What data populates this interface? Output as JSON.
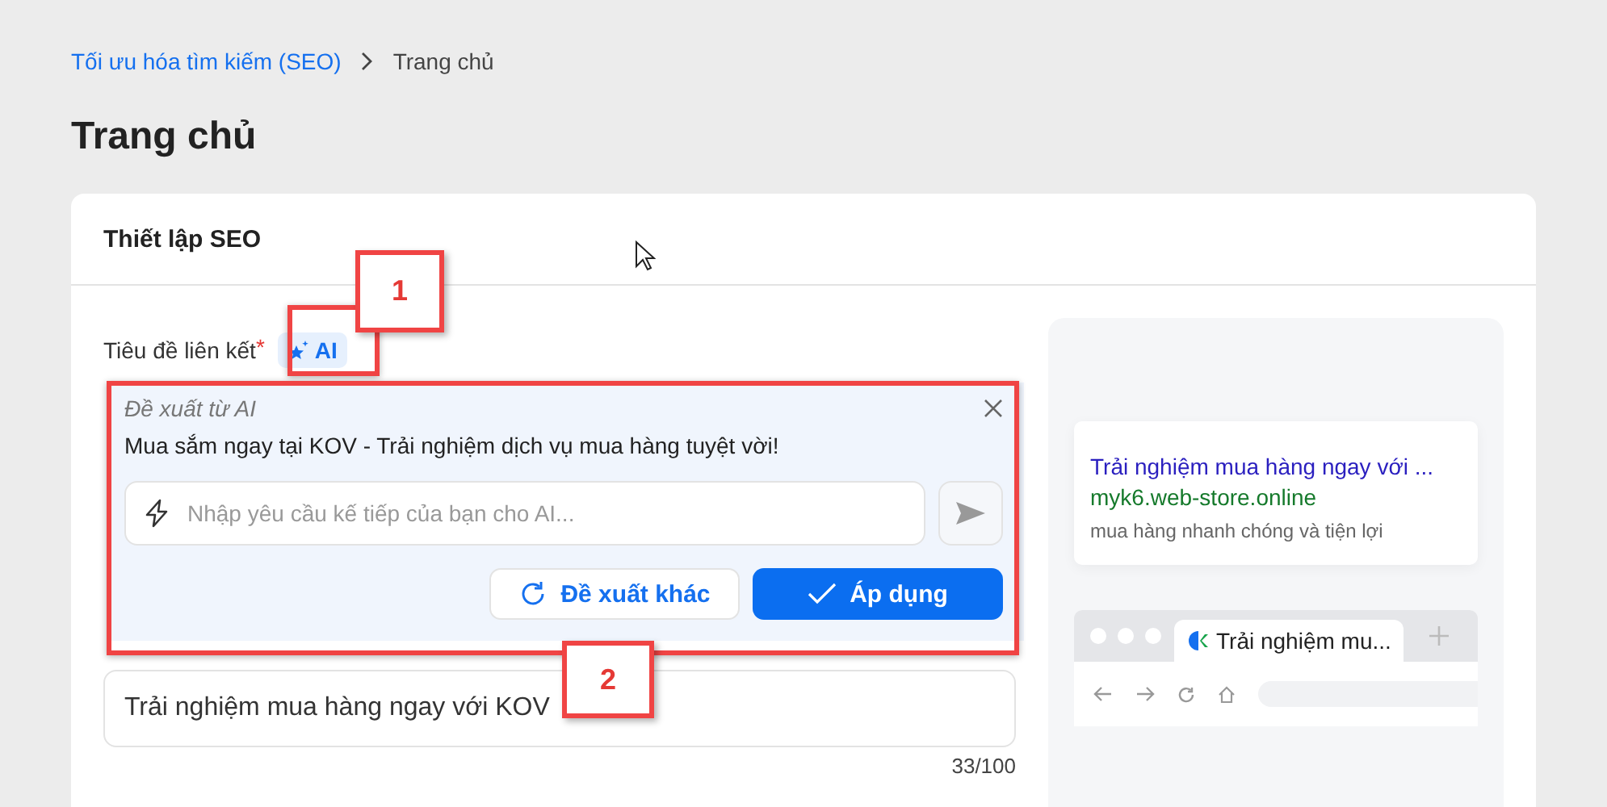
{
  "breadcrumb": [
    {
      "label": "Tối ưu hóa tìm kiếm (SEO)",
      "kind": "link"
    },
    {
      "label": "Trang chủ",
      "kind": "current"
    }
  ],
  "page_title": "Trang chủ",
  "card": {
    "title": "Thiết lập SEO"
  },
  "field": {
    "label": "Tiêu đề liên kết",
    "required": true,
    "required_mark": "*",
    "ai_button": "AI",
    "value": "Trải nghiệm mua hàng ngay với KOV",
    "counter": "33/100"
  },
  "ai_panel": {
    "title": "Đề xuất từ AI",
    "suggestion": "Mua sắm ngay tại KOV - Trải nghiệm dịch vụ mua hàng tuyệt vời!",
    "prompt_placeholder": "Nhập yêu cầu kế tiếp của bạn cho AI...",
    "buttons": [
      {
        "label": "Đề xuất khác",
        "kind": "secondary"
      },
      {
        "label": "Áp dụng",
        "kind": "primary"
      }
    ]
  },
  "preview": {
    "result_title": "Trải nghiệm mua hàng ngay với ...",
    "result_url": "myk6.web-store.online",
    "result_description": "mua hàng nhanh chóng và tiện lợi",
    "browser_tab": "Trải nghiệm mu..."
  },
  "annotations": [
    {
      "label": "1"
    },
    {
      "label": "2"
    }
  ]
}
